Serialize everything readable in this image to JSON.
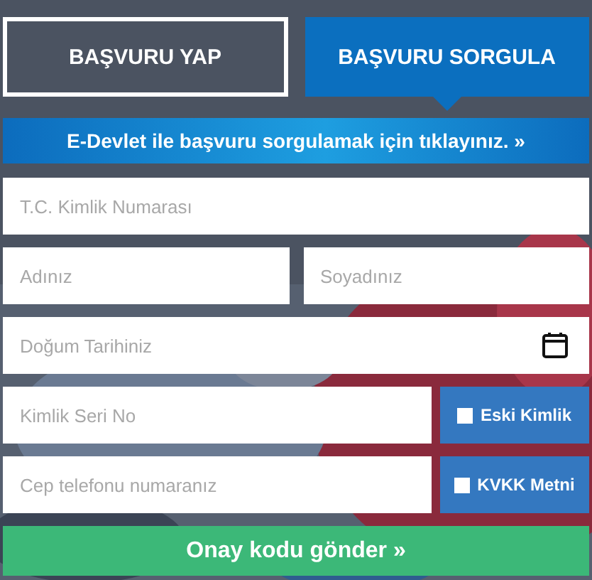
{
  "tabs": [
    {
      "label": "BAŞVURU YAP",
      "selected": false
    },
    {
      "label": "BAŞVURU SORGULA",
      "selected": true
    }
  ],
  "edevlet_link": {
    "label": "E-Devlet ile başvuru sorgulamak için tıklayınız.",
    "arrow": "»"
  },
  "fields": [
    {
      "placeholder": "T.C. Kimlik Numarası",
      "kind": "full"
    },
    {
      "placeholder": "Adınız",
      "kind": "half"
    },
    {
      "placeholder": "Soyadınız",
      "kind": "half"
    },
    {
      "placeholder": "Doğum Tarihiniz",
      "kind": "date"
    },
    {
      "placeholder": "Kimlik Seri No",
      "kind": "check",
      "check_label": "Eski Kimlik",
      "checked": false
    },
    {
      "placeholder": "Cep telefonu numaranız",
      "kind": "check",
      "check_label": "KVKK Metni",
      "checked": false
    }
  ],
  "submit": {
    "label": "Onay kodu gönder",
    "arrow": "»"
  }
}
